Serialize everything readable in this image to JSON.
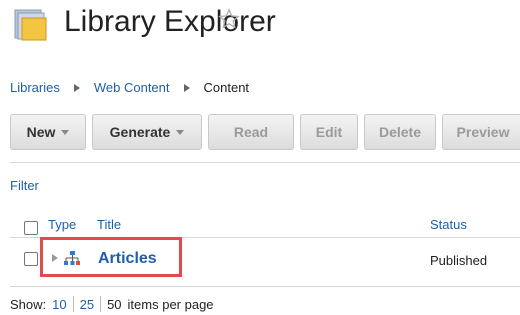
{
  "header": {
    "title": "Library Explorer",
    "icon": "folder-icon",
    "favorite_icon": "star-outline-icon"
  },
  "breadcrumb": {
    "items": [
      "Libraries",
      "Web Content",
      "Content"
    ]
  },
  "toolbar": {
    "buttons": [
      {
        "label": "New",
        "dropdown": true,
        "enabled": true
      },
      {
        "label": "Generate",
        "dropdown": true,
        "enabled": true
      },
      {
        "label": "Read",
        "dropdown": false,
        "enabled": false
      },
      {
        "label": "Edit",
        "dropdown": false,
        "enabled": false
      },
      {
        "label": "Delete",
        "dropdown": false,
        "enabled": false
      },
      {
        "label": "Preview",
        "dropdown": false,
        "enabled": false
      }
    ]
  },
  "filter": {
    "label": "Filter"
  },
  "table": {
    "columns": {
      "type": "Type",
      "title": "Title",
      "status": "Status"
    },
    "rows": [
      {
        "title": "Articles",
        "status": "Published",
        "type_icon": "site-area-hierarchy-icon"
      }
    ]
  },
  "pager": {
    "show_label": "Show:",
    "options": [
      "10",
      "25",
      "50"
    ],
    "selected": "50",
    "suffix": "items per page"
  },
  "colors": {
    "link": "#1e5fa8",
    "highlight": "#e24b4b"
  }
}
